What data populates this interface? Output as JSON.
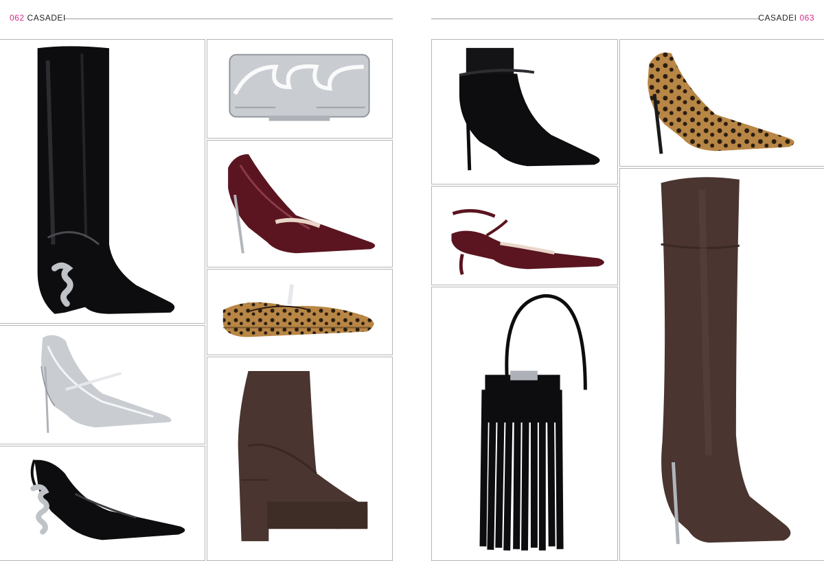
{
  "header_left": {
    "page_number": "062",
    "brand": "CASADEI"
  },
  "header_right": {
    "brand": "CASADEI",
    "page_number": "063"
  },
  "products": [
    {
      "name": "black-patent-knee-boot-icon"
    },
    {
      "name": "silver-clutch-icon"
    },
    {
      "name": "burgundy-patent-pump-icon"
    },
    {
      "name": "leopard-ballet-flat-icon"
    },
    {
      "name": "silver-mary-jane-pump-icon"
    },
    {
      "name": "black-slingback-chain-heel-icon"
    },
    {
      "name": "brown-platform-ankle-boot-icon"
    },
    {
      "name": "black-ankle-strap-bootie-icon"
    },
    {
      "name": "leopard-pump-icon"
    },
    {
      "name": "burgundy-slingback-kitten-heel-icon"
    },
    {
      "name": "black-fringe-bag-icon"
    },
    {
      "name": "brown-suede-over-knee-boot-icon"
    }
  ],
  "colors": {
    "accent": "#d12a83",
    "black_patent": "#0d0d0f",
    "burgundy": "#5a1520",
    "silver": "#c9cdd2",
    "brown_suede": "#4a3530",
    "leopard": "#b88645"
  }
}
